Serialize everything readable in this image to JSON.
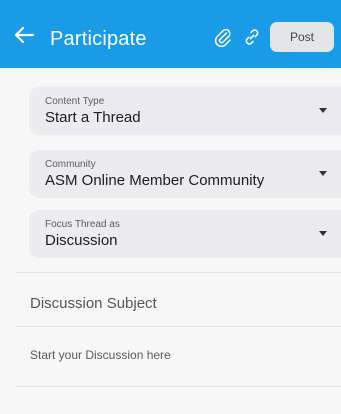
{
  "header": {
    "title": "Participate",
    "post_label": "Post",
    "colors": {
      "bar": "#1a9be6",
      "post_bg": "#e3e6e8"
    },
    "icons": [
      "arrow-left-icon",
      "paperclip-icon",
      "link-icon"
    ]
  },
  "form": {
    "content_type": {
      "label": "Content Type",
      "value": "Start a Thread"
    },
    "community": {
      "label": "Community",
      "value": "ASM Online Member Community"
    },
    "focus": {
      "label": "Focus Thread as",
      "value": "Discussion"
    },
    "subject_placeholder": "Discussion Subject",
    "body_placeholder": "Start your Discussion here"
  }
}
